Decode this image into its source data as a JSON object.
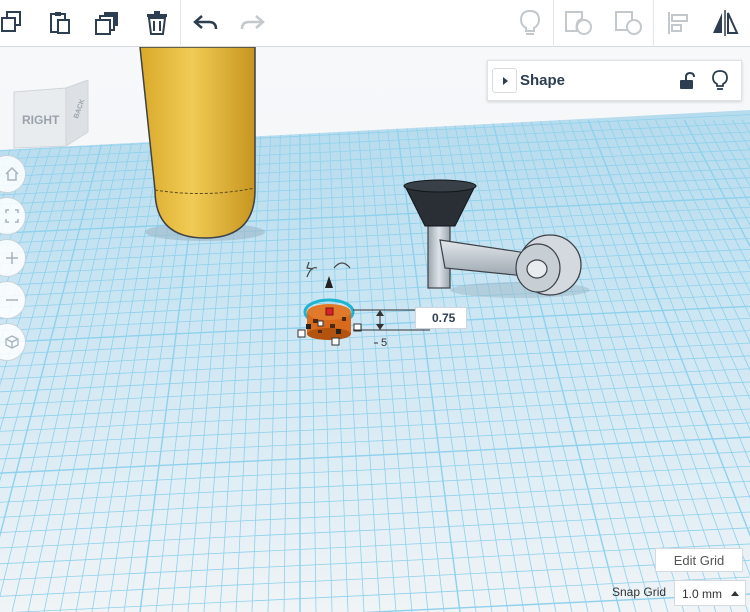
{
  "toolbar": {
    "copy_icon": "copy-icon",
    "paste_icon": "paste-icon",
    "duplicate_icon": "duplicate-icon",
    "delete_icon": "trash-icon",
    "undo_icon": "undo-icon",
    "redo_icon": "redo-icon",
    "hint_icon": "lightbulb-icon",
    "group_icon": "group-icon",
    "ungroup_icon": "ungroup-icon",
    "align_icon": "align-icon",
    "mirror_icon": "mirror-icon"
  },
  "viewcube": {
    "front_label": "RIGHT",
    "side_label": "BACK"
  },
  "view_controls": [
    "home-icon",
    "fit-view-icon",
    "zoom-in-icon",
    "zoom-out-icon",
    "perspective-icon"
  ],
  "shape_panel": {
    "title": "Shape",
    "lock_icon": "unlock-icon",
    "hint_icon": "lightbulb-icon"
  },
  "dimension": {
    "value": "0.75",
    "side_label": "5"
  },
  "grid": {
    "edit_label": "Edit Grid",
    "snap_label": "Snap Grid",
    "snap_value": "1.0 mm"
  },
  "colors": {
    "grid_line": "#8fd1ec",
    "grid_bg": "#f4f7f9",
    "selection": "#1fb4d2",
    "yellow_shape": "#e8c040",
    "dark_funnel": "#2a2f36"
  }
}
